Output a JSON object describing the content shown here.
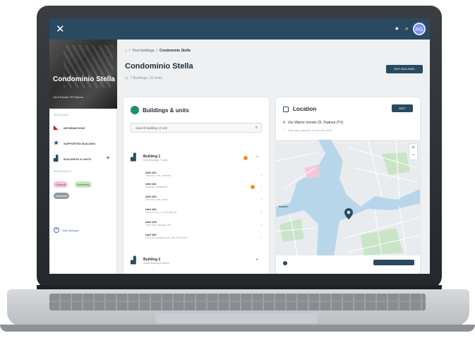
{
  "topbar": {
    "avatar": "RG"
  },
  "sidebar": {
    "title": "Condominio Stella",
    "subtitle": "Via Il Novate 25 Padova",
    "section_label": "BUILDING",
    "items": [
      {
        "label": "INFORMATIONS"
      },
      {
        "label": "SUPPORTED BUILDING"
      },
      {
        "label": "BUILDINGS & UNITS"
      }
    ],
    "section2_label": "MANAGERS",
    "chips": [
      "Consult",
      "Marketing",
      "Assistant"
    ],
    "add_manager": "Add Manager"
  },
  "main": {
    "breadcrumb": [
      "Your buildings",
      "Condominio Stella"
    ],
    "title": "Condominio Stella",
    "subtitle": "7 Buildings, 16 Units",
    "edit_label": "EDIT BUILDING"
  },
  "buildings_card": {
    "title": "Buildings & units",
    "search_placeholder": "Search building or unit",
    "building1": {
      "name": "Building 1",
      "sub": "North building, 7 Units"
    },
    "units": [
      {
        "name": "Unit 101",
        "sub": "First floor, flat, Manarini"
      },
      {
        "name": "Unit 102",
        "sub": "Housing, residential"
      },
      {
        "name": "Unit 103",
        "sub": "First floor, flat, Rossi"
      },
      {
        "name": "Unit 104",
        "sub": "Second floor, C/2 storage lot"
      },
      {
        "name": "Unit 105",
        "sub": "Third floor, storage lots"
      },
      {
        "name": "Unit 106",
        "sub": "Fifth and partially floor, with Terrazzino"
      }
    ],
    "building2": {
      "name": "Building 2",
      "sub": "South Building & Boxes"
    }
  },
  "location_card": {
    "title": "Location",
    "edit_label": "EDIT",
    "address": "Via Vittorio Veneto 25, Padova (TV)",
    "note": "Map data samples on the mid-radii",
    "map_label": "Bastion"
  },
  "colors": {
    "brand": "#294a61",
    "accent_green": "#1f8e6a",
    "status_orange": "#f0921e"
  }
}
